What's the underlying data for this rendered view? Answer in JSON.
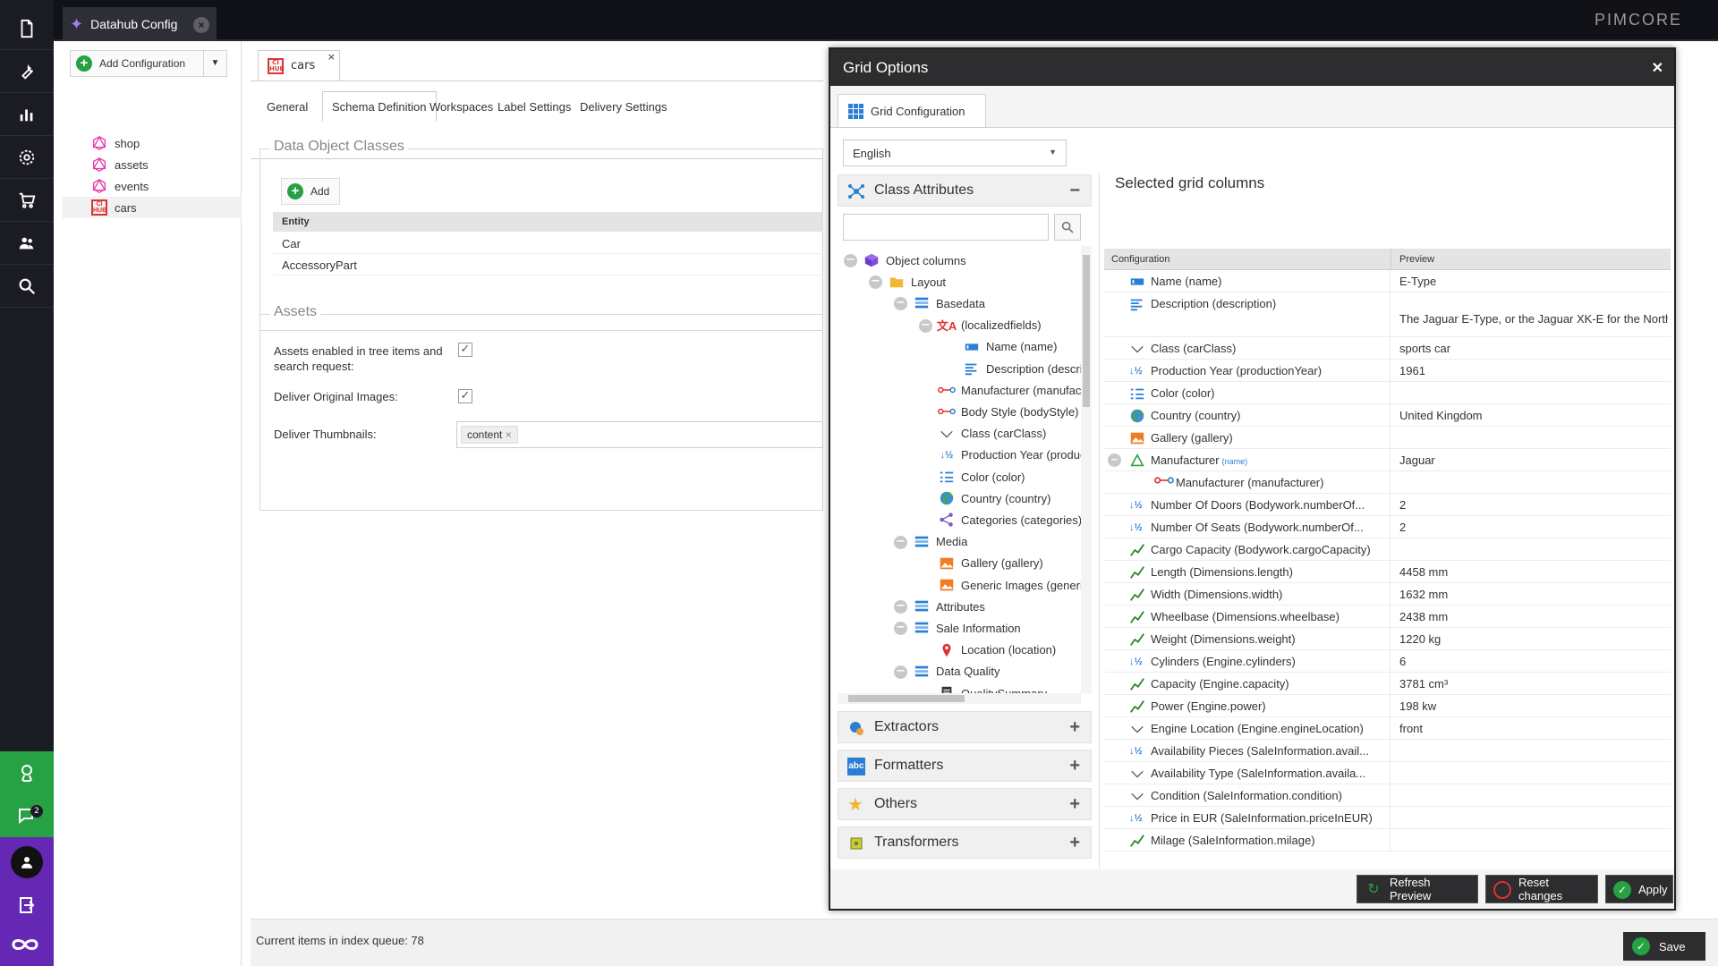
{
  "app": {
    "main_tab": "Datahub Config",
    "brand": "PIMCORE"
  },
  "config_panel": {
    "add_label": "Add Configuration",
    "items": [
      {
        "label": "shop",
        "icon": "graphql-icon"
      },
      {
        "label": "assets",
        "icon": "graphql-icon"
      },
      {
        "label": "events",
        "icon": "graphql-icon"
      },
      {
        "label": "cars",
        "icon": "ci-hub-icon"
      }
    ]
  },
  "editor": {
    "doc_tab": "cars",
    "tabs": [
      "General",
      "Schema Definition",
      "Workspaces",
      "Label Settings",
      "Delivery Settings"
    ],
    "active_tab": "Schema Definition",
    "classes_legend": "Data Object Classes",
    "add_label": "Add",
    "entity_header": "Entity",
    "entities": [
      "Car",
      "AccessoryPart"
    ],
    "assets_legend": "Assets",
    "assets_enabled_label": "Assets enabled in tree items and search request:",
    "deliver_original_label": "Deliver Original Images:",
    "deliver_thumbs_label": "Deliver Thumbnails:",
    "thumb_tag": "content"
  },
  "status": {
    "queue_text": "Current items in index queue: 78",
    "save_label": "Save"
  },
  "dialog": {
    "title": "Grid Options",
    "tab": "Grid Configuration",
    "language": "English",
    "class_attributes": "Class Attributes",
    "tree": [
      {
        "label": "Object columns",
        "indent": 0,
        "icon": "cube-icon",
        "toggle": true
      },
      {
        "label": "Layout",
        "indent": 1,
        "icon": "folder-icon",
        "toggle": true
      },
      {
        "label": "Basedata",
        "indent": 2,
        "icon": "panel-icon",
        "toggle": true
      },
      {
        "label": "(localizedfields)",
        "indent": 3,
        "icon": "translate-icon",
        "toggle": true
      },
      {
        "label": "Name (name)",
        "indent": 4,
        "icon": "input-icon"
      },
      {
        "label": "Description (description)",
        "indent": 4,
        "icon": "textarea-icon"
      },
      {
        "label": "Manufacturer (manufacturer)",
        "indent": 3,
        "icon": "relation-icon"
      },
      {
        "label": "Body Style (bodyStyle)",
        "indent": 3,
        "icon": "relation-icon"
      },
      {
        "label": "Class (carClass)",
        "indent": 3,
        "icon": "select-icon"
      },
      {
        "label": "Production Year (productionYear)",
        "indent": 3,
        "icon": "number-icon"
      },
      {
        "label": "Color (color)",
        "indent": 3,
        "icon": "multiselect-icon"
      },
      {
        "label": "Country (country)",
        "indent": 3,
        "icon": "globe-icon"
      },
      {
        "label": "Categories (categories)",
        "indent": 3,
        "icon": "share-icon"
      },
      {
        "label": "Media",
        "indent": 2,
        "icon": "panel-icon",
        "toggle": true
      },
      {
        "label": "Gallery (gallery)",
        "indent": 3,
        "icon": "image-icon"
      },
      {
        "label": "Generic Images (genericImages)",
        "indent": 3,
        "icon": "image-icon"
      },
      {
        "label": "Attributes",
        "indent": 2,
        "icon": "panel-icon",
        "toggle": true
      },
      {
        "label": "Sale Information",
        "indent": 2,
        "icon": "panel-icon",
        "toggle": true
      },
      {
        "label": "Location (location)",
        "indent": 3,
        "icon": "pin-icon"
      },
      {
        "label": "Data Quality",
        "indent": 2,
        "icon": "panel-icon",
        "toggle": true
      },
      {
        "label": "QualitySummary",
        "indent": 3,
        "icon": "summary-icon"
      }
    ],
    "extractors": "Extractors",
    "formatters": "Formatters",
    "others": "Others",
    "transformers": "Transformers",
    "selected_title": "Selected grid columns",
    "col_config": "Configuration",
    "col_preview": "Preview",
    "rows": [
      {
        "label": "Name (name)",
        "preview": "E-Type",
        "icon": "input-icon"
      },
      {
        "label": "Description (description)",
        "preview": "The Jaguar E-Type, or the Jaguar XK-E for the North",
        "icon": "textarea-icon",
        "tall": true
      },
      {
        "label": "Class (carClass)",
        "preview": "sports car",
        "icon": "select-icon"
      },
      {
        "label": "Production Year (productionYear)",
        "preview": "1961",
        "icon": "number-icon"
      },
      {
        "label": "Color (color)",
        "preview": "",
        "icon": "multiselect-icon"
      },
      {
        "label": "Country (country)",
        "preview": "United Kingdom",
        "icon": "globe-icon"
      },
      {
        "label": "Gallery (gallery)",
        "preview": "",
        "icon": "image-icon"
      },
      {
        "label": "Manufacturer",
        "sub": "(name)",
        "preview": "Jaguar",
        "icon": "recycle-icon",
        "toggle": true
      },
      {
        "label": "Manufacturer (manufacturer)",
        "preview": "",
        "icon": "relation-icon",
        "indent": true
      },
      {
        "label": "Number Of Doors (Bodywork.numberOf...",
        "preview": "2",
        "icon": "number-icon"
      },
      {
        "label": "Number Of Seats (Bodywork.numberOf...",
        "preview": "2",
        "icon": "number-icon"
      },
      {
        "label": "Cargo Capacity (Bodywork.cargoCapacity)",
        "preview": "",
        "icon": "quantity-icon"
      },
      {
        "label": "Length (Dimensions.length)",
        "preview": "4458 mm",
        "icon": "quantity-icon"
      },
      {
        "label": "Width (Dimensions.width)",
        "preview": "1632 mm",
        "icon": "quantity-icon"
      },
      {
        "label": "Wheelbase (Dimensions.wheelbase)",
        "preview": "2438 mm",
        "icon": "quantity-icon"
      },
      {
        "label": "Weight (Dimensions.weight)",
        "preview": "1220 kg",
        "icon": "quantity-icon"
      },
      {
        "label": "Cylinders (Engine.cylinders)",
        "preview": "6",
        "icon": "number-icon"
      },
      {
        "label": "Capacity (Engine.capacity)",
        "preview": "3781 cm³",
        "icon": "quantity-icon"
      },
      {
        "label": "Power (Engine.power)",
        "preview": "198 kw",
        "icon": "quantity-icon"
      },
      {
        "label": "Engine Location (Engine.engineLocation)",
        "preview": "front",
        "icon": "select-icon"
      },
      {
        "label": "Availability Pieces (SaleInformation.avail...",
        "preview": "",
        "icon": "number-icon"
      },
      {
        "label": "Availability Type (SaleInformation.availa...",
        "preview": "",
        "icon": "select-icon"
      },
      {
        "label": "Condition (SaleInformation.condition)",
        "preview": "",
        "icon": "select-icon"
      },
      {
        "label": "Price in EUR (SaleInformation.priceInEUR)",
        "preview": "",
        "icon": "number-icon"
      },
      {
        "label": "Milage (SaleInformation.milage)",
        "preview": "",
        "icon": "quantity-icon"
      }
    ],
    "buttons": {
      "refresh": "Refresh Preview",
      "reset": "Reset changes",
      "apply": "Apply"
    }
  },
  "colors": {
    "nav_bg": "#1b1b24",
    "green": "#26a144",
    "purple": "#6428b4",
    "accent_blue": "#2a7fd4"
  }
}
